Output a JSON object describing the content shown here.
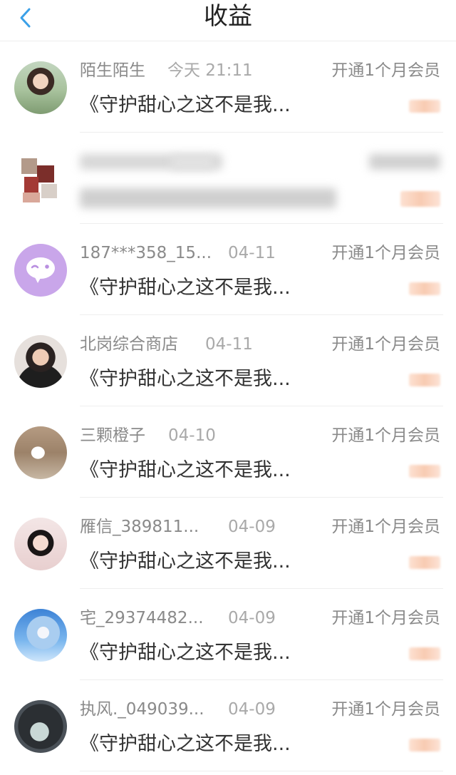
{
  "header": {
    "title": "收益"
  },
  "rows": [
    {
      "name": "陌生陌生",
      "time": "今天 21:11",
      "action": "开通1个月会员",
      "book": "《守护甜心之这不是我..."
    },
    {
      "name": "",
      "time": "",
      "action": "",
      "book": ""
    },
    {
      "name": "187***358_15...",
      "time": "04-11",
      "action": "开通1个月会员",
      "book": "《守护甜心之这不是我..."
    },
    {
      "name": "北岗综合商店",
      "time": "04-11",
      "action": "开通1个月会员",
      "book": "《守护甜心之这不是我..."
    },
    {
      "name": "三颗橙子",
      "time": "04-10",
      "action": "开通1个月会员",
      "book": "《守护甜心之这不是我..."
    },
    {
      "name": "雁信_389811...",
      "time": "04-09",
      "action": "开通1个月会员",
      "book": "《守护甜心之这不是我..."
    },
    {
      "name": "宅_29374482...",
      "time": "04-09",
      "action": "开通1个月会员",
      "book": "《守护甜心之这不是我..."
    },
    {
      "name": "执风._049039...",
      "time": "04-09",
      "action": "开通1个月会员",
      "book": "《守护甜心之这不是我..."
    }
  ]
}
